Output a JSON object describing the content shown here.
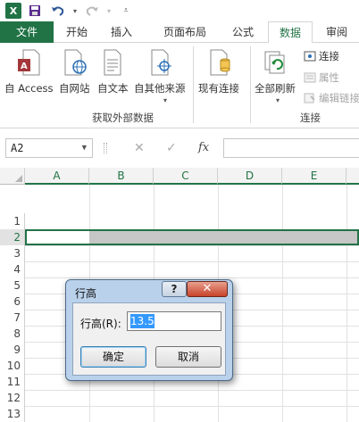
{
  "qat": {
    "logo": "X",
    "icons": [
      "excel-logo-icon",
      "save-icon",
      "undo-icon",
      "redo-icon",
      "customize-icon"
    ]
  },
  "tabs": {
    "file": "文件",
    "home": "开始",
    "insert": "插入",
    "layout": "页面布局",
    "formulas": "公式",
    "data": "数据",
    "review": "审阅"
  },
  "ribbon": {
    "from_access": "自 Access",
    "from_web": "自网站",
    "from_text": "自文本",
    "from_other": "自其他来源",
    "group_external": "获取外部数据",
    "existing_conn": "现有连接",
    "refresh_all": "全部刷新",
    "connections": "连接",
    "properties": "属性",
    "edit_links": "编辑链接",
    "group_connections": "连接"
  },
  "formula_bar": {
    "cell_ref": "A2",
    "cancel_glyph": "✕",
    "enter_glyph": "✓",
    "fx_glyph": "fx",
    "value": ""
  },
  "grid": {
    "columns": [
      "A",
      "B",
      "C",
      "D",
      "E"
    ],
    "rows": [
      "1",
      "2",
      "3",
      "4",
      "5",
      "6",
      "7",
      "8",
      "9",
      "10",
      "11",
      "12",
      "13"
    ]
  },
  "dialog": {
    "title": "行高",
    "field_label": "行高(R):",
    "field_value": "13.5",
    "ok": "确定",
    "cancel": "取消",
    "help_glyph": "?",
    "close_glyph": "✕"
  },
  "colors": {
    "accent": "#217346",
    "selection": "#c6c6c6"
  }
}
